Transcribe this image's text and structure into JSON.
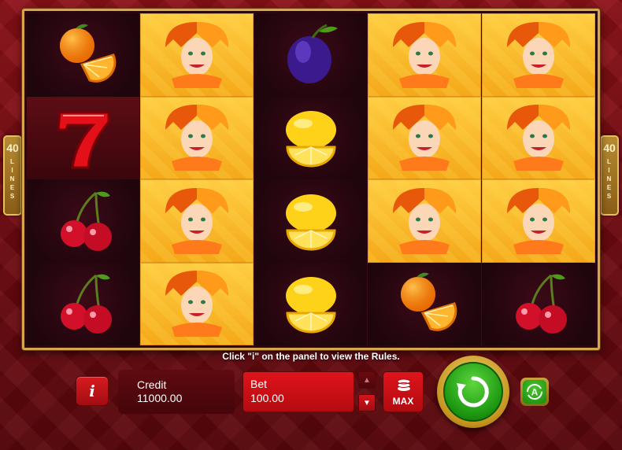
{
  "lines_badge": {
    "count": "40",
    "word": [
      "L",
      "I",
      "N",
      "E",
      "S"
    ]
  },
  "reels": [
    [
      "orange",
      "seven",
      "cherry",
      "cherry"
    ],
    [
      "jester",
      "jester",
      "jester",
      "jester"
    ],
    [
      "plum",
      "lemon",
      "lemon",
      "lemon"
    ],
    [
      "jester",
      "jester",
      "jester",
      "orange"
    ],
    [
      "jester",
      "jester",
      "jester",
      "cherry"
    ]
  ],
  "hint": "Click \"i\" on the panel to view the Rules.",
  "panel": {
    "info_label": "i",
    "credit_label": "Credit",
    "credit_value": "11000.00",
    "bet_label": "Bet",
    "bet_value": "100.00",
    "max_label": "MAX",
    "auto_label": "A"
  },
  "icons": {
    "info": "info-icon",
    "spin": "spin-icon",
    "autoplay": "autoplay-icon",
    "coins": "coins-icon",
    "bet_up": "arrow-up-icon",
    "bet_down": "arrow-down-icon"
  },
  "colors": {
    "frame_gold": "#d8a64a",
    "panel_red": "#d81b20",
    "spin_green": "#1e9a12",
    "win_yellow": "#f2a81a"
  }
}
